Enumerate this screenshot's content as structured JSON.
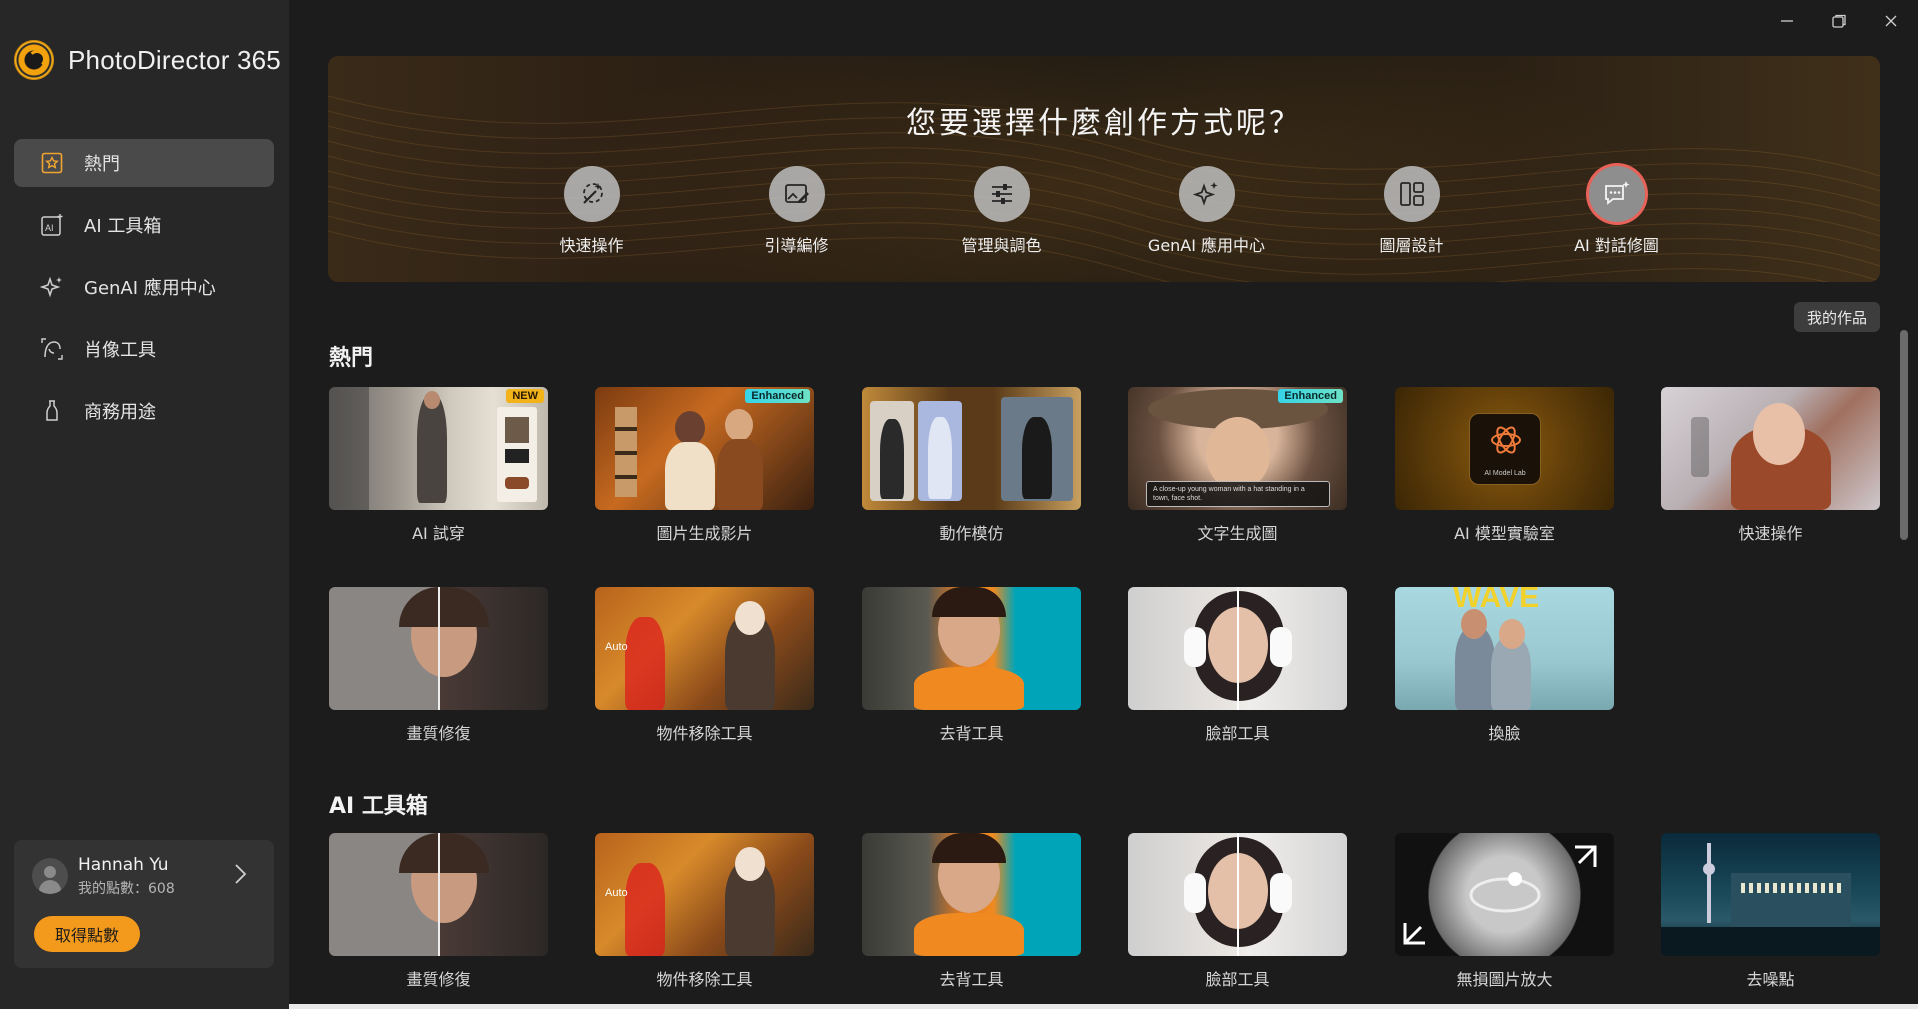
{
  "app": {
    "title": "PhotoDirector 365"
  },
  "sidebar": {
    "items": [
      {
        "label": "熱門",
        "icon": "star-square-icon",
        "active": true
      },
      {
        "label": "AI 工具箱",
        "icon": "ai-box-icon",
        "active": false
      },
      {
        "label": "GenAI 應用中心",
        "icon": "sparkle-icon",
        "active": false
      },
      {
        "label": "肖像工具",
        "icon": "portrait-icon",
        "active": false
      },
      {
        "label": "商務用途",
        "icon": "bottle-icon",
        "active": false
      }
    ]
  },
  "user": {
    "name": "Hannah Yu",
    "points": "我的點數：608",
    "get_points_label": "取得點數"
  },
  "banner": {
    "title": "您要選擇什麼創作方式呢？",
    "actions": [
      {
        "label": "快速操作",
        "icon": "magic-wand-icon"
      },
      {
        "label": "引導編修",
        "icon": "image-edit-icon"
      },
      {
        "label": "管理與調色",
        "icon": "sliders-icon"
      },
      {
        "label": "GenAI 應用中心",
        "icon": "sparkle-icon"
      },
      {
        "label": "圖層設計",
        "icon": "layout-icon"
      },
      {
        "label": "AI 對話修圖",
        "icon": "chat-sparkle-icon"
      }
    ]
  },
  "my_works_label": "我的作品",
  "sections": {
    "popular": {
      "title": "熱門",
      "cards": [
        {
          "label": "AI 試穿",
          "badge": "NEW"
        },
        {
          "label": "圖片生成影片",
          "badge": "Enhanced"
        },
        {
          "label": "動作模仿",
          "badge": ""
        },
        {
          "label": "文字生成圖",
          "badge": "Enhanced",
          "caption": "A close-up young woman with a hat standing in a town, face shot."
        },
        {
          "label": "AI 模型實驗室",
          "badge": "",
          "caption": "AI Model Lab"
        },
        {
          "label": "快速操作",
          "badge": ""
        },
        {
          "label": "畫質修復",
          "badge": ""
        },
        {
          "label": "物件移除工具",
          "badge": "",
          "caption": "Auto"
        },
        {
          "label": "去背工具",
          "badge": ""
        },
        {
          "label": "臉部工具",
          "badge": ""
        },
        {
          "label": "換臉",
          "badge": "",
          "caption": "WAVE"
        }
      ]
    },
    "ai_toolbox": {
      "title": "AI 工具箱",
      "cards": [
        {
          "label": "畫質修復"
        },
        {
          "label": "物件移除工具",
          "caption": "Auto"
        },
        {
          "label": "去背工具"
        },
        {
          "label": "臉部工具"
        },
        {
          "label": "無損圖片放大"
        },
        {
          "label": "去噪點"
        }
      ]
    }
  },
  "colors": {
    "accent": "#f39a1c",
    "highlight_ring": "#e8625a",
    "badge_new": "#f2b21a",
    "badge_enhanced": "#35d4e8"
  }
}
